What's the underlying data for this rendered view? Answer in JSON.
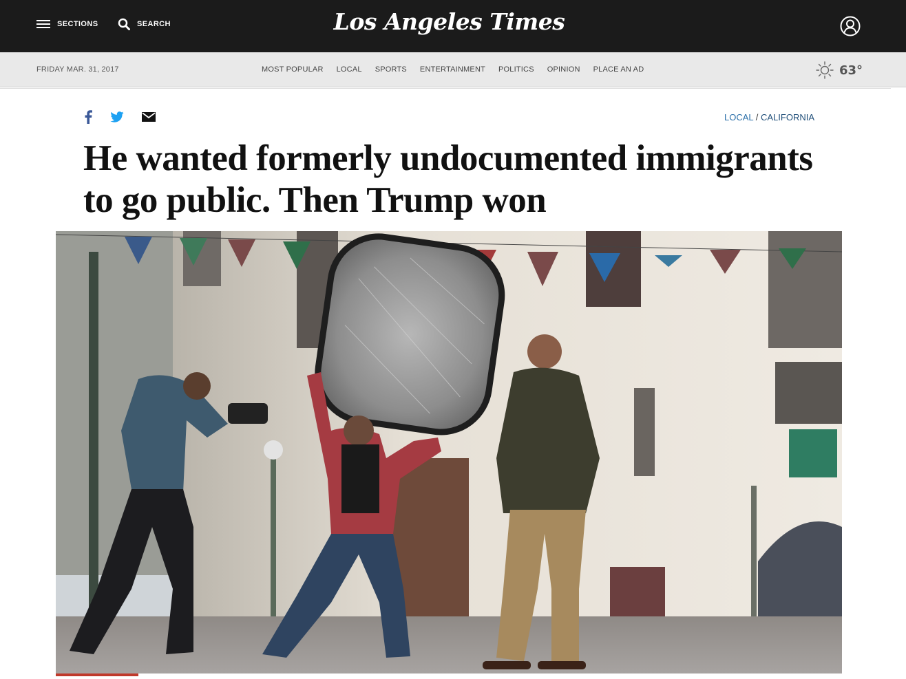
{
  "header": {
    "sections_label": "SECTIONS",
    "search_label": "SEARCH",
    "logo_text": "Los Angeles Times"
  },
  "subnav": {
    "date": "FRIDAY MAR. 31, 2017",
    "links": [
      "MOST POPULAR",
      "LOCAL",
      "SPORTS",
      "ENTERTAINMENT",
      "POLITICS",
      "OPINION",
      "PLACE AN AD"
    ],
    "weather_temp": "63°",
    "weather_icon": "sun-icon"
  },
  "share": {
    "icons": [
      "facebook-icon",
      "twitter-icon",
      "email-icon"
    ]
  },
  "breadcrumb": {
    "section": "LOCAL",
    "separator": " / ",
    "subsection": "CALIFORNIA"
  },
  "article": {
    "headline": "He wanted formerly undocumented immigrants to go public. Then Trump won"
  },
  "colors": {
    "header_bg": "#1b1b1b",
    "subnav_bg": "#e9e9e9",
    "link_blue": "#2a6fa8",
    "facebook": "#3b5998",
    "twitter": "#1da1f2"
  }
}
